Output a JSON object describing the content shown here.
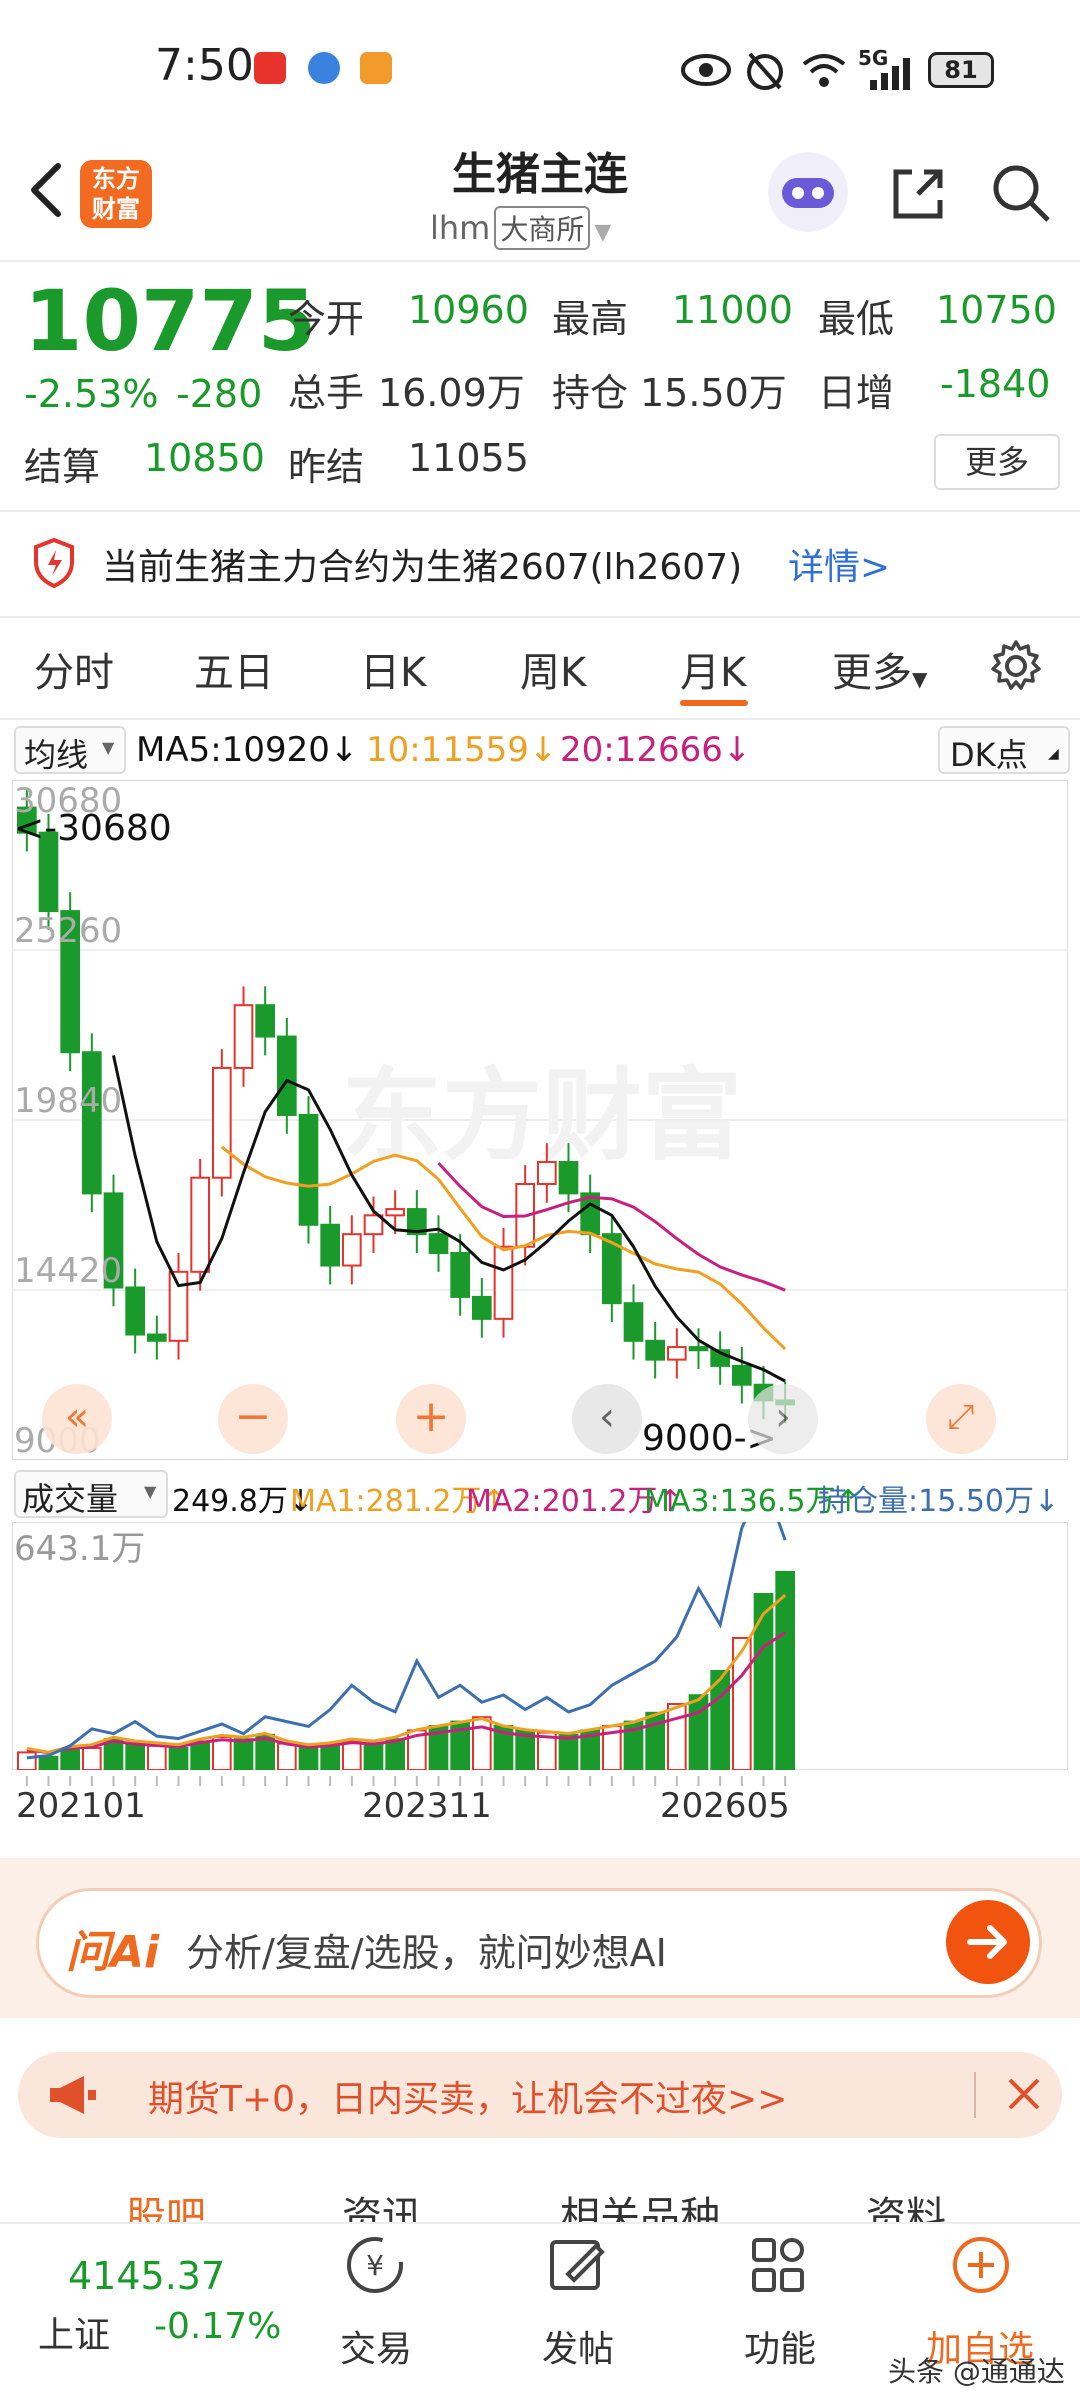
{
  "status_bar": {
    "time": "7:50",
    "network": "5G",
    "battery": "81"
  },
  "header": {
    "logo_text_line1": "东方",
    "logo_text_line2": "财富",
    "title": "生猪主连",
    "code": "lhm",
    "exchange": "大商所"
  },
  "quote": {
    "price": "10775",
    "change_pct": "-2.53%",
    "change_abs": "-280",
    "open_label": "今开",
    "open": "10960",
    "high_label": "最高",
    "high": "11000",
    "low_label": "最低",
    "low": "10750",
    "volume_label": "总手",
    "volume": "16.09万",
    "oi_label": "持仓",
    "oi": "15.50万",
    "daily_inc_label": "日增",
    "daily_inc": "-1840",
    "settle_label": "结算",
    "settle": "10850",
    "prev_settle_label": "昨结",
    "prev_settle": "11055",
    "more_label": "更多"
  },
  "notice": {
    "text": "当前生猪主力合约为生猪2607(lh2607)",
    "link": "详情>"
  },
  "tabs": [
    {
      "label": "分时"
    },
    {
      "label": "五日"
    },
    {
      "label": "日K"
    },
    {
      "label": "周K"
    },
    {
      "label": "月K"
    },
    {
      "label": "更多"
    }
  ],
  "active_tab": "月K",
  "ma_row": {
    "selector": "均线",
    "ma5": "MA5:10920↓",
    "ma10": "10:11559↓",
    "ma20": "20:12666↓",
    "dk": "DK点"
  },
  "price_axis": {
    "labels": [
      "30680",
      "25260",
      "19840",
      "14420",
      "9000"
    ],
    "max_marker": "<-30680",
    "min_marker": "9000->"
  },
  "volume_row": {
    "selector": "成交量",
    "vol": "249.8万↓",
    "ma1": "MA1:281.2万↑",
    "ma2": "MA2:201.2万↑",
    "ma3": "MA3:136.5万↑",
    "oi": "持仓量:15.50万↓",
    "max_label": "643.1万"
  },
  "x_axis": {
    "labels": [
      "202101",
      "202311",
      "202605"
    ]
  },
  "watermark": "东方财富",
  "colors": {
    "up": "#e8322c",
    "down": "#1a9a2a",
    "accent": "#ef6a1f",
    "ma5": "#111111",
    "ma10": "#f0a020",
    "ma20": "#c8207e",
    "oi_line": "#3d6fb0"
  },
  "ai_bar": {
    "logo": "问Ai",
    "placeholder": "分析/复盘/选股，就问妙想AI"
  },
  "promo": {
    "text": "期货T+0，日内买卖，让机会不过夜>>"
  },
  "sub_tabs": [
    {
      "label": "股吧"
    },
    {
      "label": "资讯"
    },
    {
      "label": "相关品种"
    },
    {
      "label": "资料"
    }
  ],
  "bottom_nav": {
    "index_value": "4145.37",
    "index_name": "上证",
    "index_change": "-0.17%",
    "items": [
      {
        "label": "交易",
        "icon": "trade-icon"
      },
      {
        "label": "发帖",
        "icon": "post-icon"
      },
      {
        "label": "功能",
        "icon": "function-grid-icon"
      },
      {
        "label": "加自选",
        "icon": "add-watch-icon"
      }
    ]
  },
  "footer_watermark": "头条 @通通达"
}
